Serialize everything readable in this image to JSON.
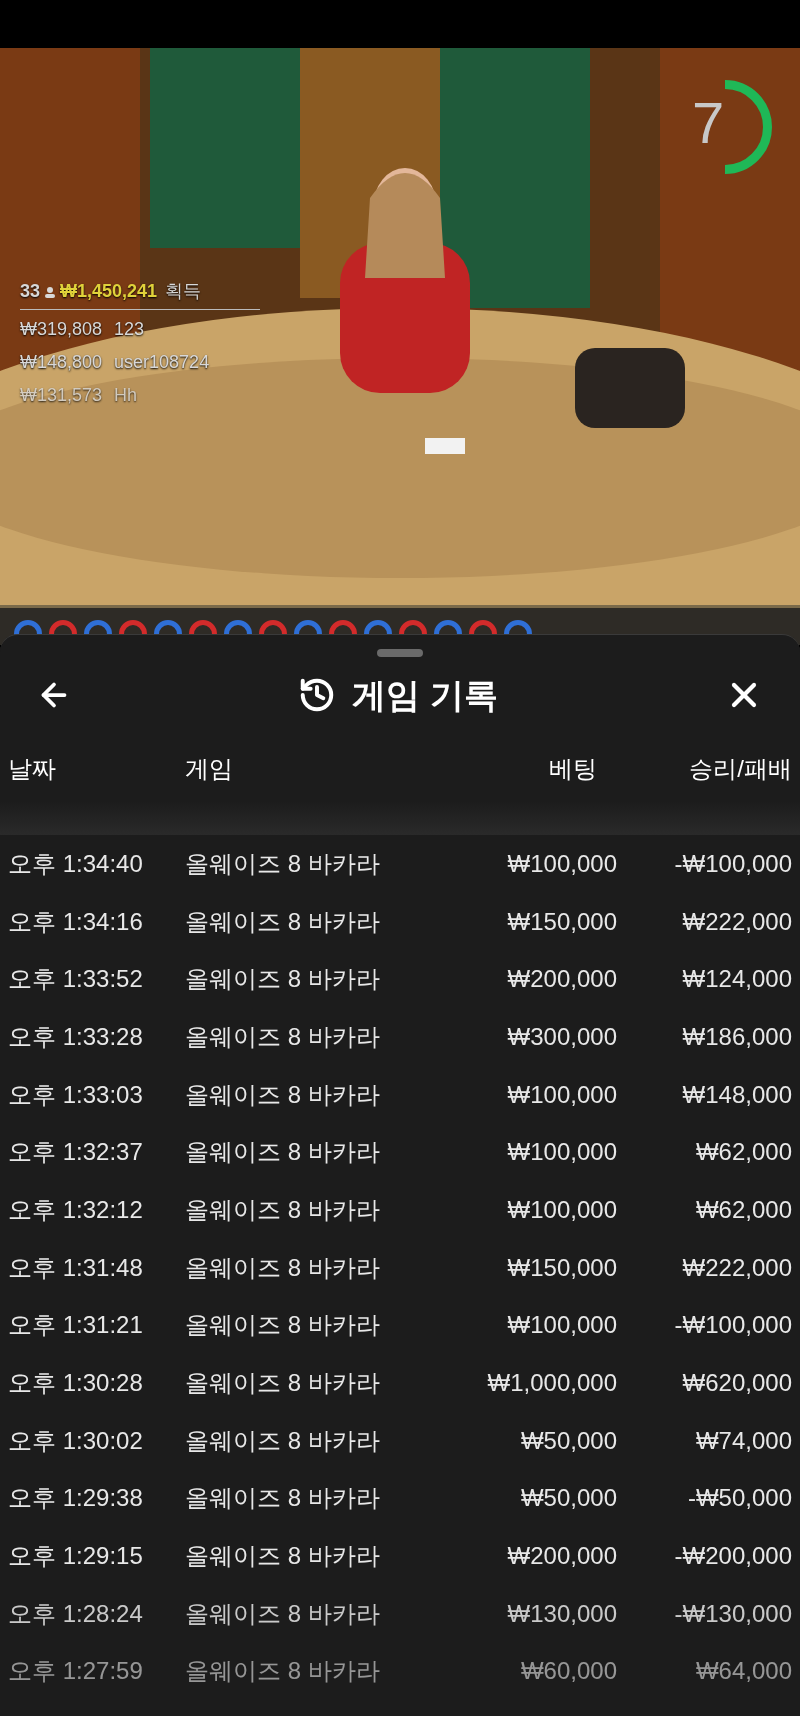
{
  "video": {
    "kind": "picture",
    "leaderboard": {
      "players": "33",
      "total": "₩1,450,241",
      "total_label": "획득",
      "rows": [
        {
          "amount": "₩319,808",
          "name": "123"
        },
        {
          "amount": "₩148,800",
          "name": "user108724"
        },
        {
          "amount": "₩131,573",
          "name": "Hh"
        }
      ]
    },
    "timer": {
      "value": "7"
    }
  },
  "road": [
    {
      "color": "#2f6fd6"
    },
    {
      "color": "#d22b2b"
    },
    {
      "color": "#2f6fd6"
    },
    {
      "color": "#d22b2b"
    },
    {
      "color": "#2f6fd6"
    },
    {
      "color": "#d22b2b"
    },
    {
      "color": "#2f6fd6"
    },
    {
      "color": "#d22b2b"
    },
    {
      "color": "#2f6fd6"
    },
    {
      "color": "#d22b2b"
    },
    {
      "color": "#2f6fd6"
    },
    {
      "color": "#d22b2b"
    },
    {
      "color": "#2f6fd6"
    },
    {
      "color": "#d22b2b"
    },
    {
      "color": "#2f6fd6"
    }
  ],
  "sheet": {
    "title": "게임 기록",
    "columns": [
      "날짜",
      "게임",
      "베팅",
      "승리/패배"
    ],
    "rows": [
      {
        "date": "오후 1:34:40",
        "game": "올웨이즈 8 바카라",
        "bet": "₩100,000",
        "result": "-₩100,000"
      },
      {
        "date": "오후 1:34:16",
        "game": "올웨이즈 8 바카라",
        "bet": "₩150,000",
        "result": "₩222,000"
      },
      {
        "date": "오후 1:33:52",
        "game": "올웨이즈 8 바카라",
        "bet": "₩200,000",
        "result": "₩124,000"
      },
      {
        "date": "오후 1:33:28",
        "game": "올웨이즈 8 바카라",
        "bet": "₩300,000",
        "result": "₩186,000"
      },
      {
        "date": "오후 1:33:03",
        "game": "올웨이즈 8 바카라",
        "bet": "₩100,000",
        "result": "₩148,000"
      },
      {
        "date": "오후 1:32:37",
        "game": "올웨이즈 8 바카라",
        "bet": "₩100,000",
        "result": "₩62,000"
      },
      {
        "date": "오후 1:32:12",
        "game": "올웨이즈 8 바카라",
        "bet": "₩100,000",
        "result": "₩62,000"
      },
      {
        "date": "오후 1:31:48",
        "game": "올웨이즈 8 바카라",
        "bet": "₩150,000",
        "result": "₩222,000"
      },
      {
        "date": "오후 1:31:21",
        "game": "올웨이즈 8 바카라",
        "bet": "₩100,000",
        "result": "-₩100,000"
      },
      {
        "date": "오후 1:30:28",
        "game": "올웨이즈 8 바카라",
        "bet": "₩1,000,000",
        "result": "₩620,000"
      },
      {
        "date": "오후 1:30:02",
        "game": "올웨이즈 8 바카라",
        "bet": "₩50,000",
        "result": "₩74,000"
      },
      {
        "date": "오후 1:29:38",
        "game": "올웨이즈 8 바카라",
        "bet": "₩50,000",
        "result": "-₩50,000"
      },
      {
        "date": "오후 1:29:15",
        "game": "올웨이즈 8 바카라",
        "bet": "₩200,000",
        "result": "-₩200,000"
      },
      {
        "date": "오후 1:28:24",
        "game": "올웨이즈 8 바카라",
        "bet": "₩130,000",
        "result": "-₩130,000"
      },
      {
        "date": "오후 1:27:59",
        "game": "올웨이즈 8 바카라",
        "bet": "₩60,000",
        "result": "₩64,000"
      }
    ]
  }
}
